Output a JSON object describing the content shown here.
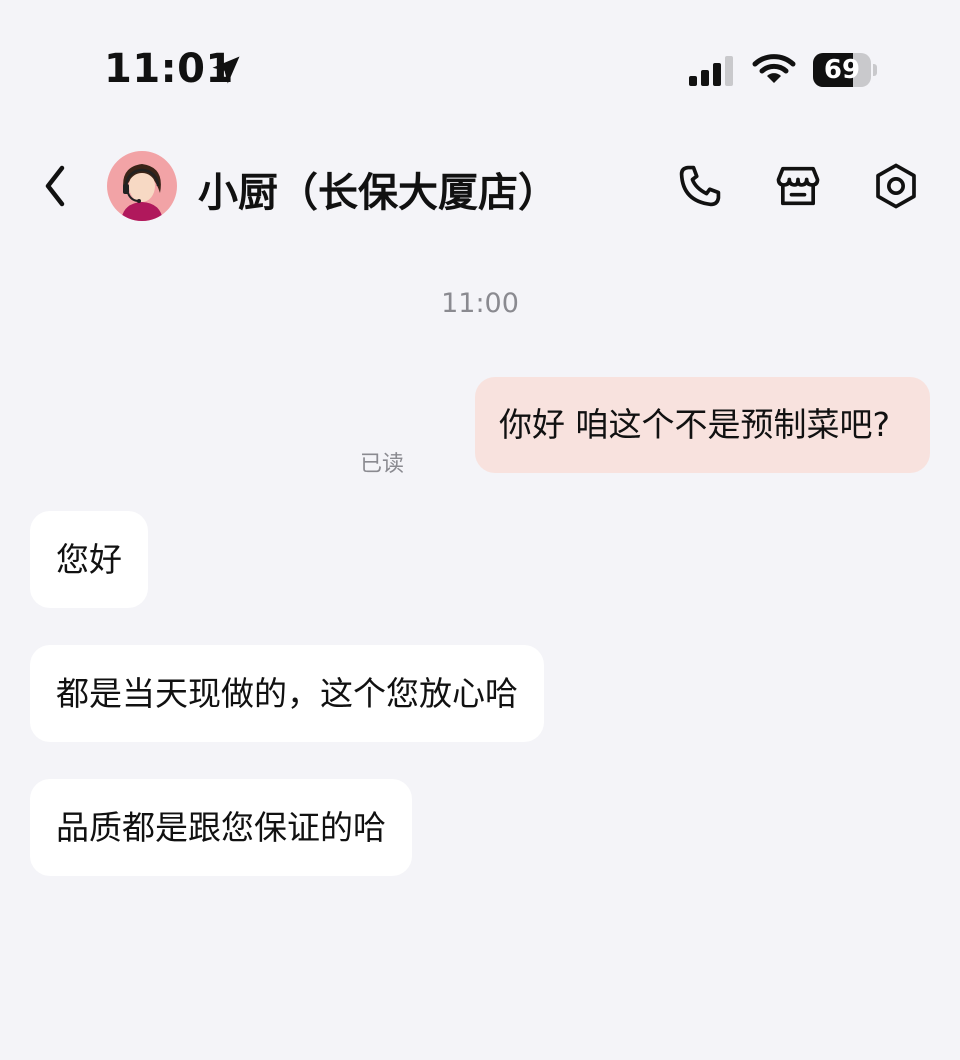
{
  "status_bar": {
    "time": "11:01",
    "battery_level": "69",
    "icons": [
      "location-arrow-icon",
      "cellular-signal-icon",
      "wifi-icon",
      "battery-icon"
    ]
  },
  "header": {
    "contact_name": "小厨（长保大厦店）",
    "icons": [
      "chevron-left-icon",
      "agent-avatar",
      "phone-icon",
      "store-icon",
      "hexagon-settings-icon"
    ]
  },
  "chat": {
    "timestamp": "11:00",
    "outgoing": {
      "text": "你好 咱这个不是预制菜吧?",
      "status": "已读"
    },
    "incoming": [
      {
        "text": "您好"
      },
      {
        "text": "都是当天现做的，这个您放心哈"
      },
      {
        "text": "品质都是跟您保证的哈"
      }
    ]
  },
  "colors": {
    "background": "#f4f4f8",
    "outgoing_bubble": "#f8e2de",
    "incoming_bubble": "#ffffff",
    "muted_text": "#8a8a90",
    "avatar_bg": "#f2a3a6"
  }
}
